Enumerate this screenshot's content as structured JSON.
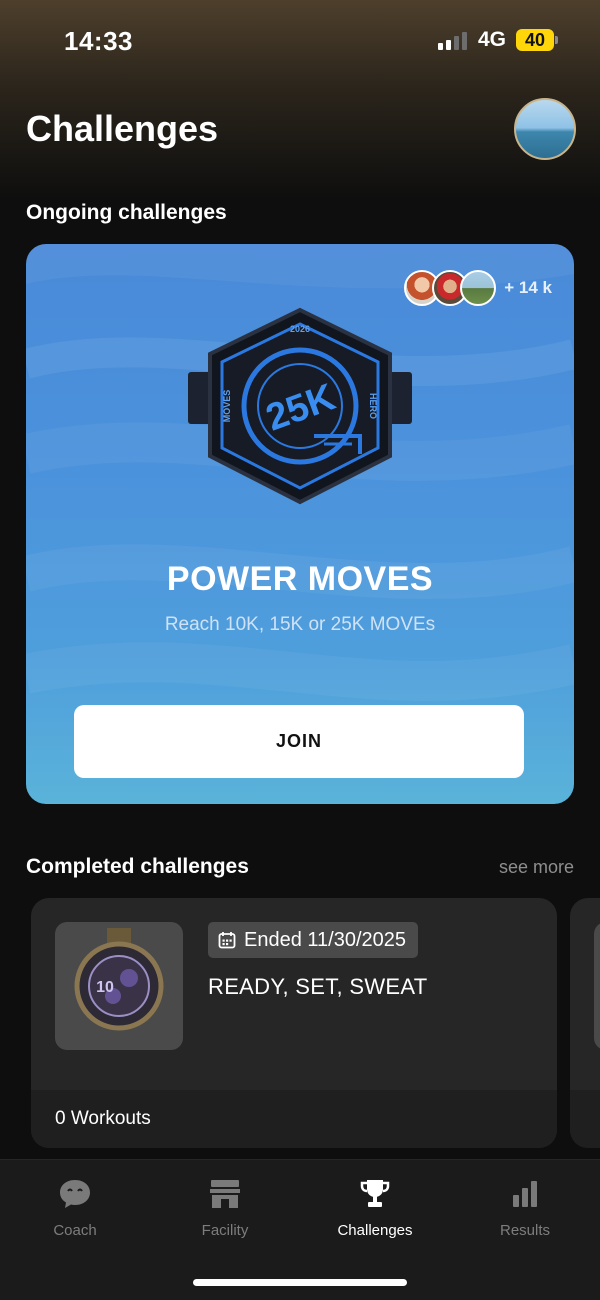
{
  "status_bar": {
    "time": "14:33",
    "network": "4G",
    "battery": "40"
  },
  "header": {
    "title": "Challenges"
  },
  "ongoing": {
    "section_title": "Ongoing challenges",
    "challenge": {
      "participants_more": "+ 14 k",
      "badge": {
        "year": "2026",
        "main": "25K",
        "left": "MOVES",
        "right": "HERO"
      },
      "name": "POWER MOVES",
      "subtitle": "Reach 10K, 15K or 25K MOVEs",
      "join_label": "JOIN",
      "colors": {
        "card_top": "#4a8ad8",
        "card_bottom": "#5ab3d9"
      }
    }
  },
  "completed": {
    "section_title": "Completed challenges",
    "see_more": "see more",
    "items": [
      {
        "ended": "Ended 11/30/2025",
        "title": "READY, SET, SWEAT",
        "workouts": "0 Workouts"
      }
    ]
  },
  "tabs": [
    {
      "label": "Coach",
      "icon": "chat-bubble-icon",
      "active": false
    },
    {
      "label": "Facility",
      "icon": "storefront-icon",
      "active": false
    },
    {
      "label": "Challenges",
      "icon": "trophy-icon",
      "active": true
    },
    {
      "label": "Results",
      "icon": "bar-chart-icon",
      "active": false
    }
  ]
}
